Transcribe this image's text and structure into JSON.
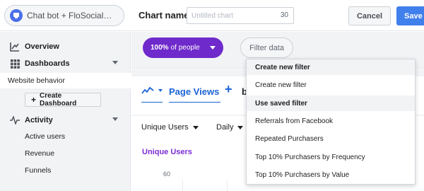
{
  "header": {
    "app_name": "Chat bot + FloSocial…",
    "chart_name_label": "Chart name",
    "chart_name_placeholder": "Untitled chart",
    "chart_name_value": "",
    "char_count": "30",
    "cancel_label": "Cancel",
    "save_label": "Save"
  },
  "sidebar": {
    "overview": "Overview",
    "dashboards": "Dashboards",
    "website_behavior": "Website behavior",
    "create_dashboard": "Create Dashboard",
    "activity": "Activity",
    "activity_items": [
      "Active users",
      "Revenue",
      "Funnels"
    ]
  },
  "filter_bar": {
    "people_pct": "100%",
    "people_suffix": "of people",
    "filter_data": "Filter data"
  },
  "main": {
    "metric_name": "Page Views",
    "cut_text": "b",
    "unique_users_dropdown": "Unique Users",
    "interval_dropdown": "Daily",
    "chart_title": "Unique Users",
    "y_tick": "60"
  },
  "filter_menu": {
    "create_header": "Create new filter",
    "create_item": "Create new filter",
    "saved_header": "Use saved filter",
    "saved_items": [
      "Referrals from Facebook",
      "Repeated Purchasers",
      "Top 10% Purchasers by Frequency",
      "Top 10% Purchasers by Value"
    ]
  },
  "colors": {
    "accent_purple": "#6f2acb",
    "link_blue": "#1a64d6",
    "save_blue": "#4080ec"
  }
}
